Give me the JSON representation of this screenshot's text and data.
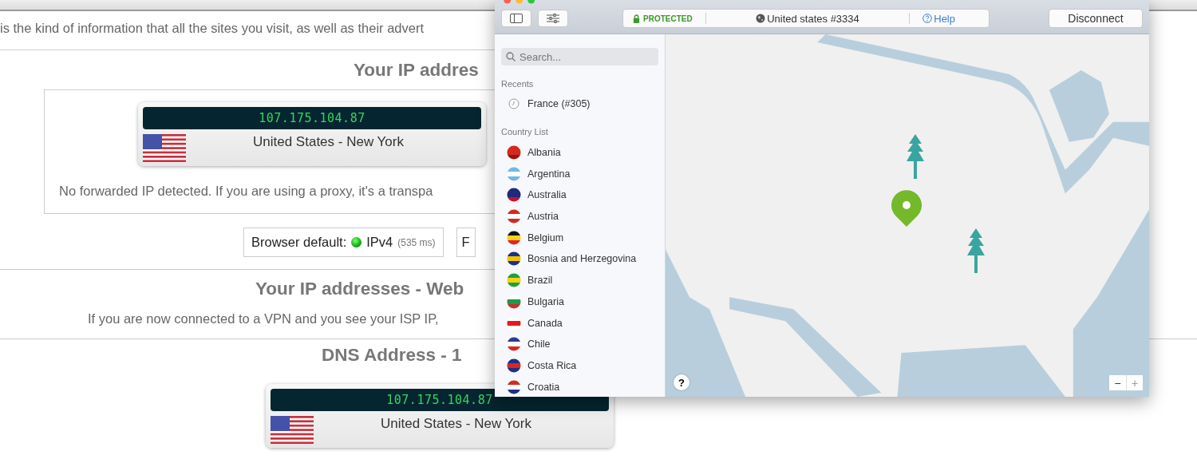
{
  "page": {
    "intro": "is the kind of information that all the sites you visit, as well as their advert",
    "ip_heading": "Your IP addres",
    "ip_card": {
      "ip": "107.175.104.87",
      "location": "United States - New York"
    },
    "forwarded_note": "No forwarded IP detected. If you are using a proxy, it's a transpa",
    "protocol_buttons": [
      {
        "label": "Browser default:",
        "protocol": "IPv4",
        "latency": "(535 ms)"
      },
      {
        "label": "F"
      }
    ],
    "webrtc_heading": "Your IP addresses - Web",
    "webrtc_note": "If you are now connected to a VPN and you see your ISP IP,",
    "dns_heading": "DNS Address - 1",
    "dns_card": {
      "ip": "107.175.104.87",
      "location": "United States - New York"
    }
  },
  "vpn": {
    "status": "PROTECTED",
    "server": "United states #3334",
    "help": "Help",
    "disconnect": "Disconnect",
    "search": {
      "placeholder": "Search..."
    },
    "recents_title": "Recents",
    "recents": [
      "France (#305)"
    ],
    "countries_title": "Country List",
    "countries": [
      "Albania",
      "Argentina",
      "Australia",
      "Austria",
      "Belgium",
      "Bosnia and Herzegovina",
      "Brazil",
      "Bulgaria",
      "Canada",
      "Chile",
      "Costa Rica",
      "Croatia"
    ],
    "help_button": "?",
    "zoom_out": "−",
    "zoom_in": "+"
  }
}
